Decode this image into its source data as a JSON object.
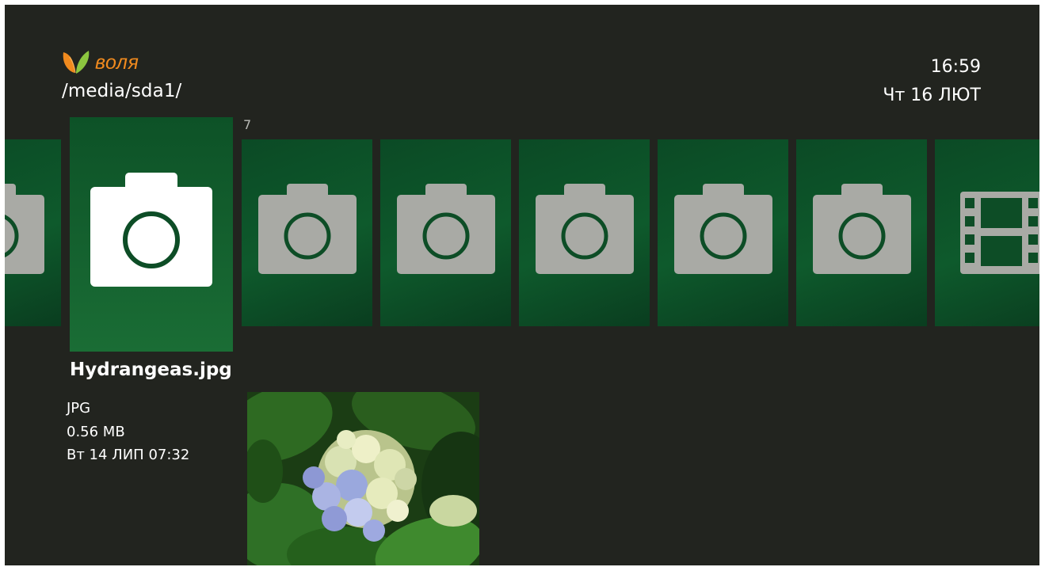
{
  "brand": {
    "name": "воля",
    "accent_color": "#f08a1e"
  },
  "header": {
    "path": "/media/sda1/",
    "time": "16:59",
    "date": "Чт 16 ЛЮТ"
  },
  "carousel": {
    "count_label": "7",
    "items": [
      {
        "type": "photo",
        "icon": "camera-icon"
      },
      {
        "type": "photo",
        "icon": "camera-icon",
        "selected": true
      },
      {
        "type": "photo",
        "icon": "camera-icon"
      },
      {
        "type": "photo",
        "icon": "camera-icon"
      },
      {
        "type": "photo",
        "icon": "camera-icon"
      },
      {
        "type": "photo",
        "icon": "camera-icon"
      },
      {
        "type": "photo",
        "icon": "camera-icon"
      },
      {
        "type": "video",
        "icon": "film-icon"
      }
    ]
  },
  "selected_file": {
    "name": "Hydrangeas.jpg",
    "format": "JPG",
    "size": "0.56 MB",
    "modified": "Вт 14 ЛИП 07:32",
    "preview": "hydrangea flower photo thumbnail"
  }
}
